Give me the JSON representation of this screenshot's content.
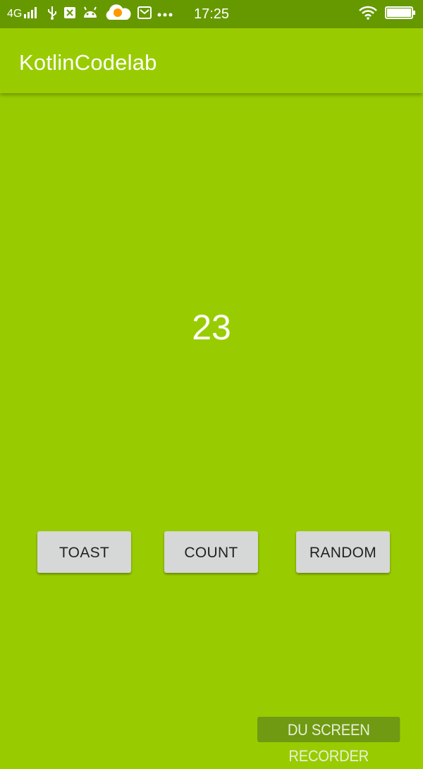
{
  "status_bar": {
    "network": "4G",
    "time": "17:25",
    "icons": [
      "signal-icon",
      "usb-icon",
      "sim-icon",
      "android-icon",
      "cloud-icon",
      "message-icon",
      "more-icon",
      "wifi-icon",
      "battery-icon"
    ]
  },
  "app_bar": {
    "title": "KotlinCodelab"
  },
  "main": {
    "count": "23"
  },
  "buttons": {
    "toast": "TOAST",
    "count": "COUNT",
    "random": "RANDOM"
  },
  "watermark": {
    "text": "DU SCREEN RECORDER"
  },
  "colors": {
    "status_bar": "#669900",
    "background": "#99cc00",
    "button": "#d6d7d7"
  }
}
